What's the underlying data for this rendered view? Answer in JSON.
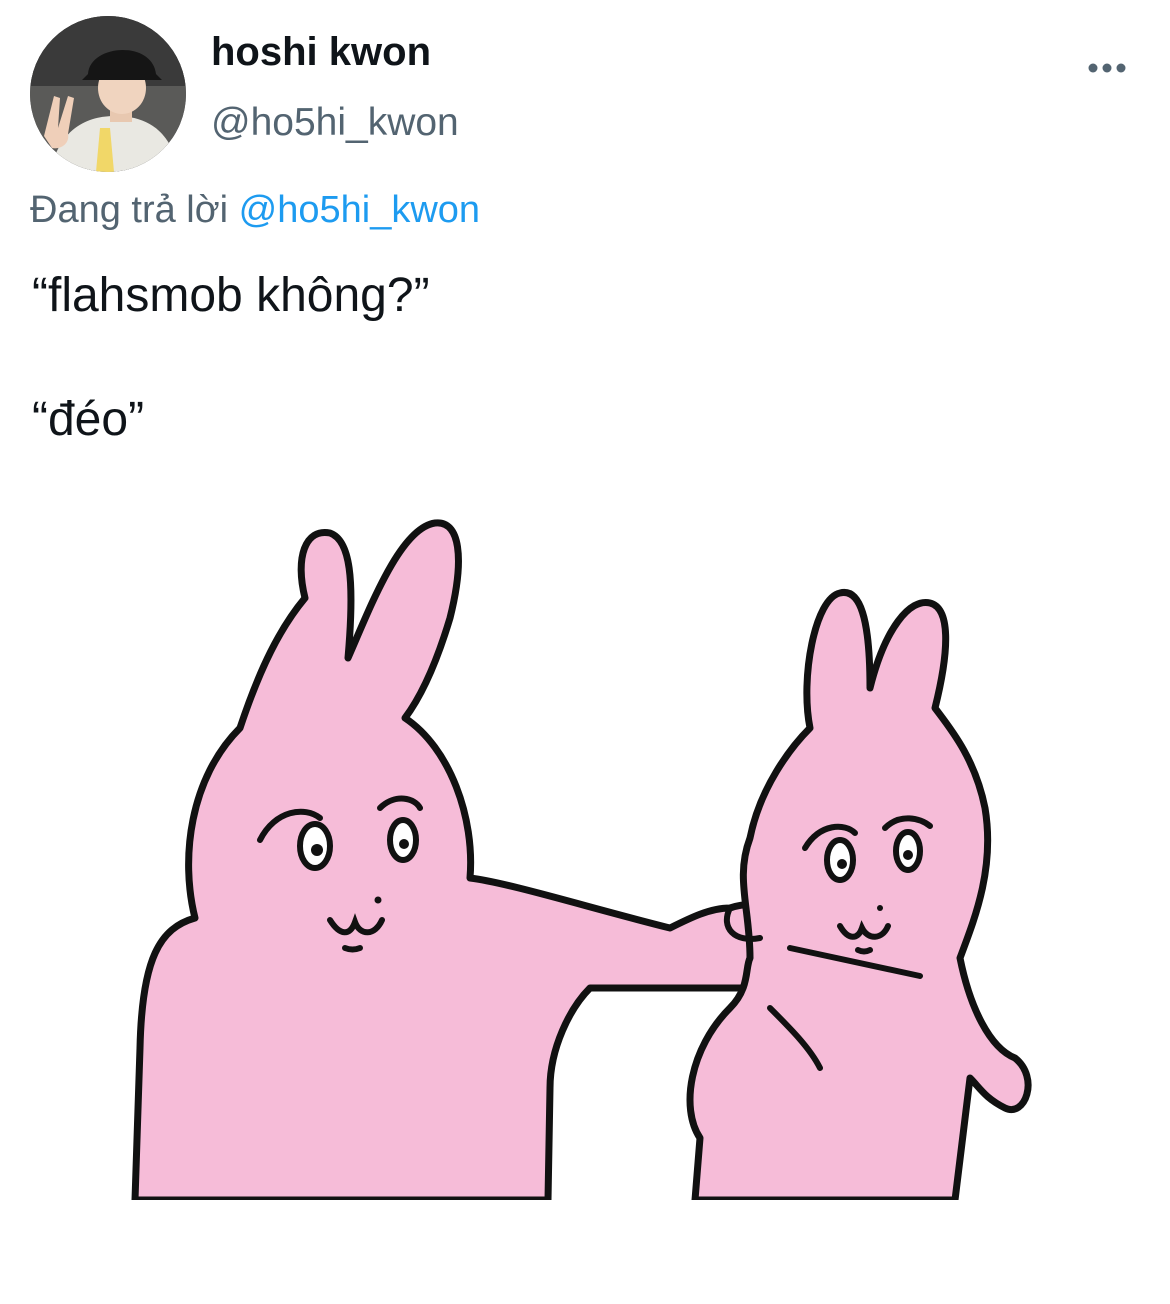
{
  "tweet": {
    "author": {
      "display_name": "hoshi kwon",
      "handle": "@ho5hi_kwon",
      "avatar_icon": "profile-photo"
    },
    "more_icon": "more-horizontal-icon",
    "replying_prefix": "Đang trả lời",
    "replying_to": "@ho5hi_kwon",
    "text_lines": [
      "“flahsmob không?”",
      "“đéo”"
    ],
    "media": {
      "type": "illustration",
      "subject": "two pink bunnies, one grabbing the other's shoulder"
    }
  },
  "colors": {
    "text_primary": "#0f1419",
    "text_secondary": "#536471",
    "accent": "#1d9bf0",
    "bunny_pink": "#f6bcd8",
    "outline": "#111111"
  }
}
